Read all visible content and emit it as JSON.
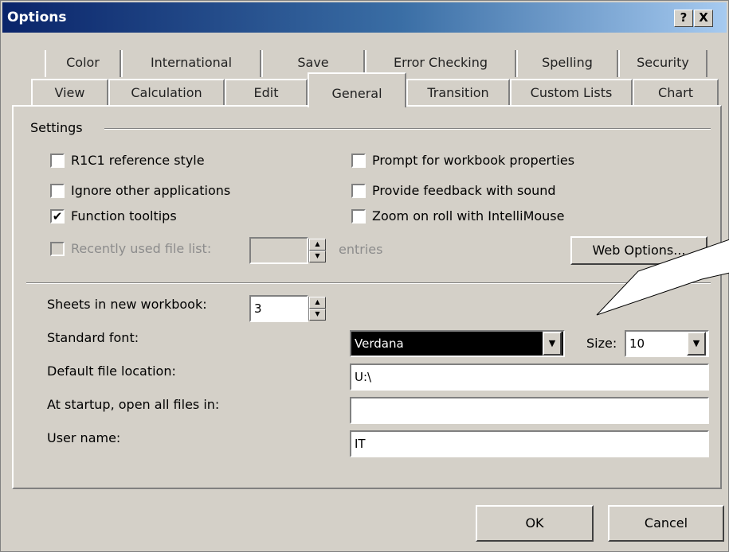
{
  "window": {
    "title": "Options",
    "help_label": "?",
    "close_label": "X"
  },
  "tabs": {
    "row1": [
      "Color",
      "International",
      "Save",
      "Error Checking",
      "Spelling",
      "Security"
    ],
    "row2": [
      "View",
      "Calculation",
      "Edit",
      "General",
      "Transition",
      "Custom Lists",
      "Chart"
    ],
    "active": "General"
  },
  "settings": {
    "group_label": "Settings",
    "r1c1": {
      "label": "R1C1 reference style",
      "checked": false
    },
    "ignore_apps": {
      "label": "Ignore other applications",
      "checked": false
    },
    "function_tooltips": {
      "label": "Function tooltips",
      "checked": true
    },
    "recently_used": {
      "label": "Recently used file list:",
      "checked": false,
      "disabled": true,
      "value": "",
      "suffix": "entries"
    },
    "prompt_props": {
      "label": "Prompt for workbook properties",
      "checked": false
    },
    "feedback_sound": {
      "label": "Provide feedback with sound",
      "checked": false
    },
    "zoom_roll": {
      "label": "Zoom on roll with IntelliMouse",
      "checked": false
    },
    "web_options_label": "Web Options..."
  },
  "fields": {
    "sheets_label": "Sheets in new workbook:",
    "sheets_value": "3",
    "font_label": "Standard font:",
    "font_value": "Verdana",
    "size_label": "Size:",
    "size_value": "10",
    "location_label": "Default file location:",
    "location_value": "U:\\",
    "startup_label": "At startup, open all files in:",
    "startup_value": "",
    "username_label": "User name:",
    "username_value": "IT"
  },
  "buttons": {
    "ok": "OK",
    "cancel": "Cancel"
  },
  "icons": {
    "check": "✔",
    "spin_up": "▲",
    "spin_down": "▼",
    "dropdown": "▼"
  }
}
